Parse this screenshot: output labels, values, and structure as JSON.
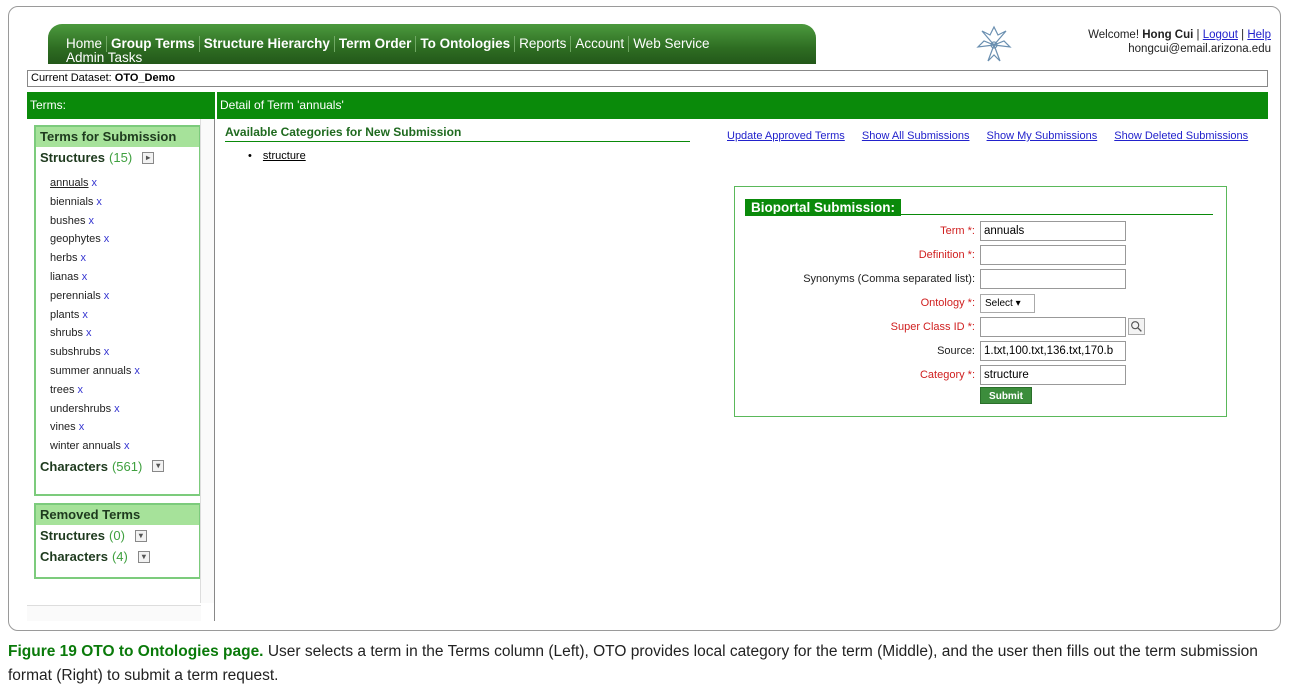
{
  "nav": {
    "items": [
      {
        "label": "Home",
        "bold": false
      },
      {
        "label": "Group Terms",
        "bold": true
      },
      {
        "label": "Structure Hierarchy",
        "bold": true
      },
      {
        "label": "Term Order",
        "bold": true
      },
      {
        "label": "To Ontologies",
        "bold": true
      },
      {
        "label": "Reports",
        "bold": false
      },
      {
        "label": "Account",
        "bold": false
      },
      {
        "label": "Web Service",
        "bold": false
      }
    ],
    "admin": "Admin Tasks"
  },
  "header": {
    "welcome_prefix": "Welcome!",
    "user": "Hong Cui",
    "sep1": "|",
    "logout": "Logout",
    "sep2": "|",
    "help": "Help",
    "email": "hongcui@email.arizona.edu"
  },
  "dataset": {
    "label": "Current Dataset:",
    "value": "OTO_Demo"
  },
  "left": {
    "heading": "Terms:",
    "submission_title": "Terms for Submission",
    "structures": {
      "label": "Structures",
      "count": "(15)"
    },
    "terms": [
      "annuals",
      "biennials",
      "bushes",
      "geophytes",
      "herbs",
      "lianas",
      "perennials",
      "plants",
      "shrubs",
      "subshrubs",
      "summer annuals",
      "trees",
      "undershrubs",
      "vines",
      "winter annuals"
    ],
    "remove_mark": "x",
    "characters": {
      "label": "Characters",
      "count": "(561)"
    },
    "removed_title": "Removed Terms",
    "removed_structures": {
      "label": "Structures",
      "count": "(0)"
    },
    "removed_characters": {
      "label": "Characters",
      "count": "(4)"
    }
  },
  "detail": {
    "heading": "Detail of Term 'annuals'",
    "available_title": "Available Categories for New Submission",
    "categories": [
      "structure"
    ],
    "links": [
      "Update Approved Terms",
      "Show All Submissions",
      "Show My Submissions",
      "Show Deleted Submissions"
    ]
  },
  "form": {
    "title": "Bioportal Submission:",
    "fields": [
      {
        "label": "Term *:",
        "required": true,
        "type": "input",
        "value": "annuals"
      },
      {
        "label": "Definition *:",
        "required": true,
        "type": "input",
        "value": ""
      },
      {
        "label": "Synonyms (Comma separated list):",
        "required": false,
        "type": "input",
        "value": ""
      },
      {
        "label": "Ontology *:",
        "required": true,
        "type": "select",
        "value": "Select"
      },
      {
        "label": "Super Class ID *:",
        "required": true,
        "type": "search",
        "value": ""
      },
      {
        "label": "Source:",
        "required": false,
        "type": "input",
        "value": "1.txt,100.txt,136.txt,170.b"
      },
      {
        "label": "Category *:",
        "required": true,
        "type": "input",
        "value": "structure"
      }
    ],
    "submit": "Submit"
  },
  "caption": {
    "fig": "Figure 19 OTO to Ontologies page.",
    "text": "User selects a term in the Terms column (Left), OTO provides local category for the term (Middle), and the user then fills out the term submission format (Right) to submit a term request."
  },
  "colors": {
    "brand_green": "#0a8a0a",
    "required_red": "#d02020",
    "link_blue": "#2222cc"
  }
}
